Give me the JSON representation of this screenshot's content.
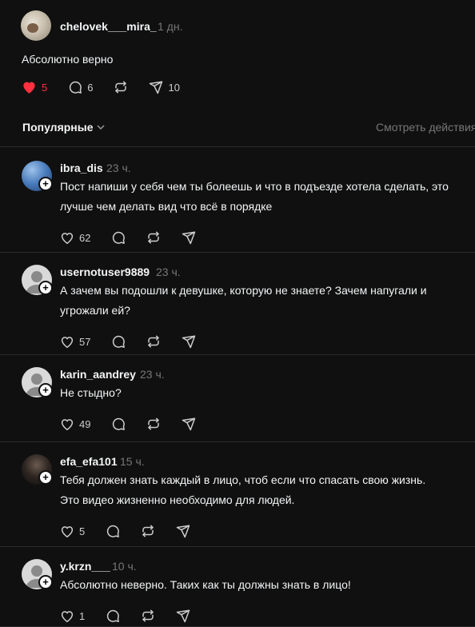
{
  "top_post": {
    "username": "chelovek___mira_",
    "time": "1 дн.",
    "text": "Абсолютно верно",
    "likes": "5",
    "replies": "6",
    "shares": "10"
  },
  "sort": {
    "label": "Популярные",
    "view_activity": "Смотреть действия"
  },
  "comments": [
    {
      "username": "ibra_dis",
      "time": "23 ч.",
      "text_lines": [
        "Пост напиши у себя чем ты болеешь и что в подъезде хотела сделать, это",
        "лучше чем делать вид что всё в порядке"
      ],
      "likes": "62"
    },
    {
      "username": "usernotuser9889",
      "time": "23 ч.",
      "text_lines": [
        "А зачем вы подошли к девушке, которую не знаете? Зачем напугали и",
        "угрожали ей?"
      ],
      "likes": "57"
    },
    {
      "username": "karin_aandrey",
      "time": "23 ч.",
      "text_lines": [
        "Не стыдно?"
      ],
      "likes": "49"
    },
    {
      "username": "efa_efa101",
      "time": "15 ч.",
      "text_lines": [
        "Тебя должен знать каждый в лицо, чтоб если что спасать свою жизнь.",
        "Это видео жизненно необходимо для людей."
      ],
      "likes": "5"
    },
    {
      "username": "y.krzn___",
      "time": "10 ч.",
      "text_lines": [
        "Абсолютно неверно. Таких как ты должны знать в лицо!"
      ],
      "likes": "1"
    }
  ],
  "colors": {
    "background": "#101010",
    "like_active": "#ff3040",
    "muted": "#777777"
  },
  "icons": [
    "heart-icon",
    "comment-icon",
    "repost-icon",
    "share-icon",
    "chevron-down-icon",
    "follow-plus-icon",
    "avatar-placeholder-icon"
  ]
}
